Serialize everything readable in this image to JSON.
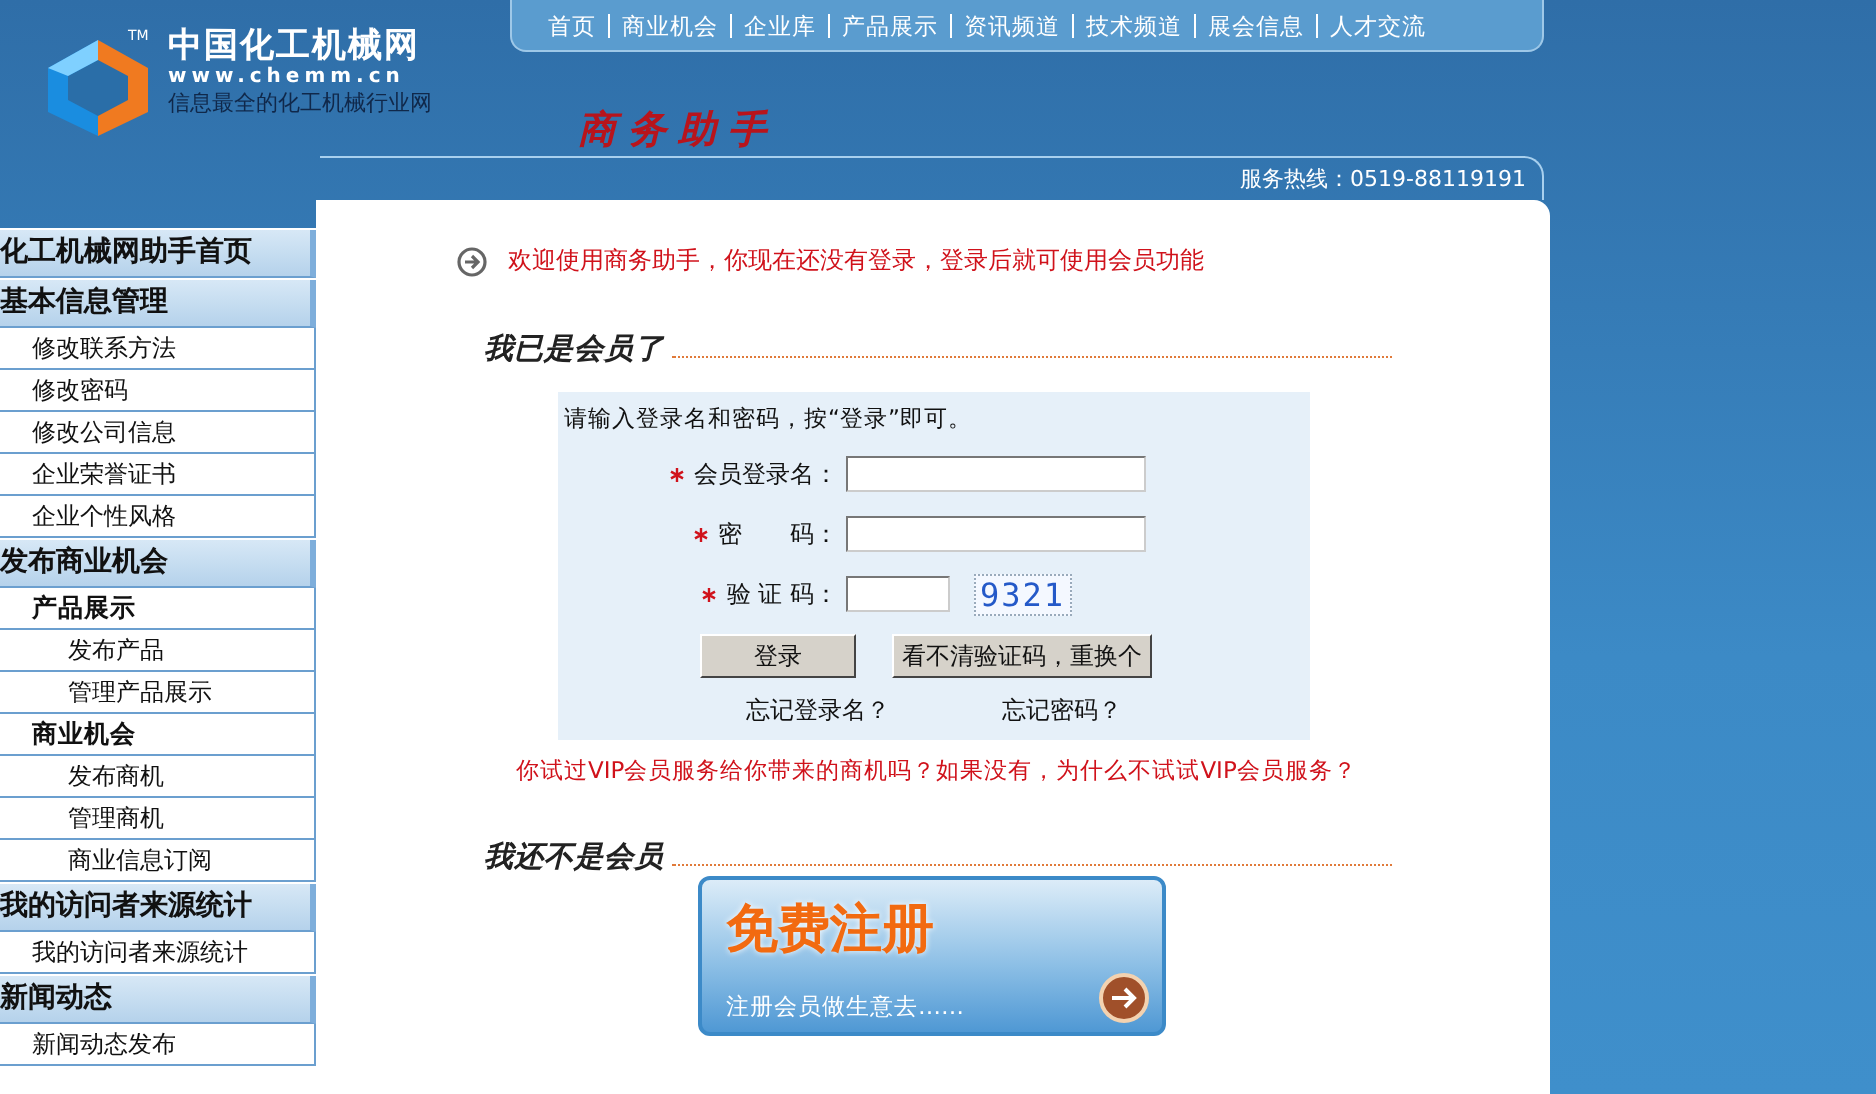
{
  "header": {
    "logo_name": "中国化工机械网",
    "trademark": "TM",
    "logo_url": "www.chemm.cn",
    "tagline": "信息最全的化工机械行业网",
    "subtitle": "商务助手",
    "nav": [
      "首页",
      "商业机会",
      "企业库",
      "产品展示",
      "资讯频道",
      "技术频道",
      "展会信息",
      "人才交流"
    ],
    "hotline": "服务热线：0519-88119191"
  },
  "sidebar": [
    {
      "kind": "header",
      "label": "化工机械网助手首页"
    },
    {
      "kind": "header",
      "label": "基本信息管理"
    },
    {
      "kind": "item",
      "label": "修改联系方法"
    },
    {
      "kind": "item",
      "label": "修改密码"
    },
    {
      "kind": "item",
      "label": "修改公司信息"
    },
    {
      "kind": "item",
      "label": "企业荣誉证书"
    },
    {
      "kind": "item",
      "label": "企业个性风格"
    },
    {
      "kind": "header",
      "label": "发布商业机会"
    },
    {
      "kind": "group",
      "label": "产品展示"
    },
    {
      "kind": "subitem",
      "label": "发布产品"
    },
    {
      "kind": "subitem",
      "label": "管理产品展示"
    },
    {
      "kind": "group",
      "label": "商业机会"
    },
    {
      "kind": "subitem",
      "label": "发布商机"
    },
    {
      "kind": "subitem",
      "label": "管理商机"
    },
    {
      "kind": "subitem",
      "label": "商业信息订阅"
    },
    {
      "kind": "header",
      "label": "我的访问者来源统计"
    },
    {
      "kind": "item",
      "label": "我的访问者来源统计"
    },
    {
      "kind": "header",
      "label": "新闻动态"
    },
    {
      "kind": "item",
      "label": "新闻动态发布"
    }
  ],
  "main": {
    "welcome": "欢迎使用商务助手，你现在还没有登录，登录后就可使用会员功能",
    "member_section": {
      "title": "我已是会员了",
      "instructions": "请输入登录名和密码，按“登录”即可。",
      "fields": [
        {
          "kind": "text",
          "label": "会员登录名：",
          "required": true
        },
        {
          "kind": "text",
          "label": "密　　码：",
          "required": true
        },
        {
          "kind": "captcha",
          "label": "验 证 码：",
          "required": true,
          "captcha": "9321"
        }
      ],
      "buttons": [
        "登录",
        "看不清验证码，重换个"
      ],
      "links": [
        "忘记登录名？",
        "忘记密码？"
      ]
    },
    "vip_prompt": "你试过VIP会员服务给你带来的商机吗？如果没有，为什么不试试VIP会员服务？",
    "nonmember_section": {
      "title": "我还不是会员",
      "register": {
        "title": "免费注册",
        "subtitle": "注册会员做生意去……"
      }
    }
  }
}
